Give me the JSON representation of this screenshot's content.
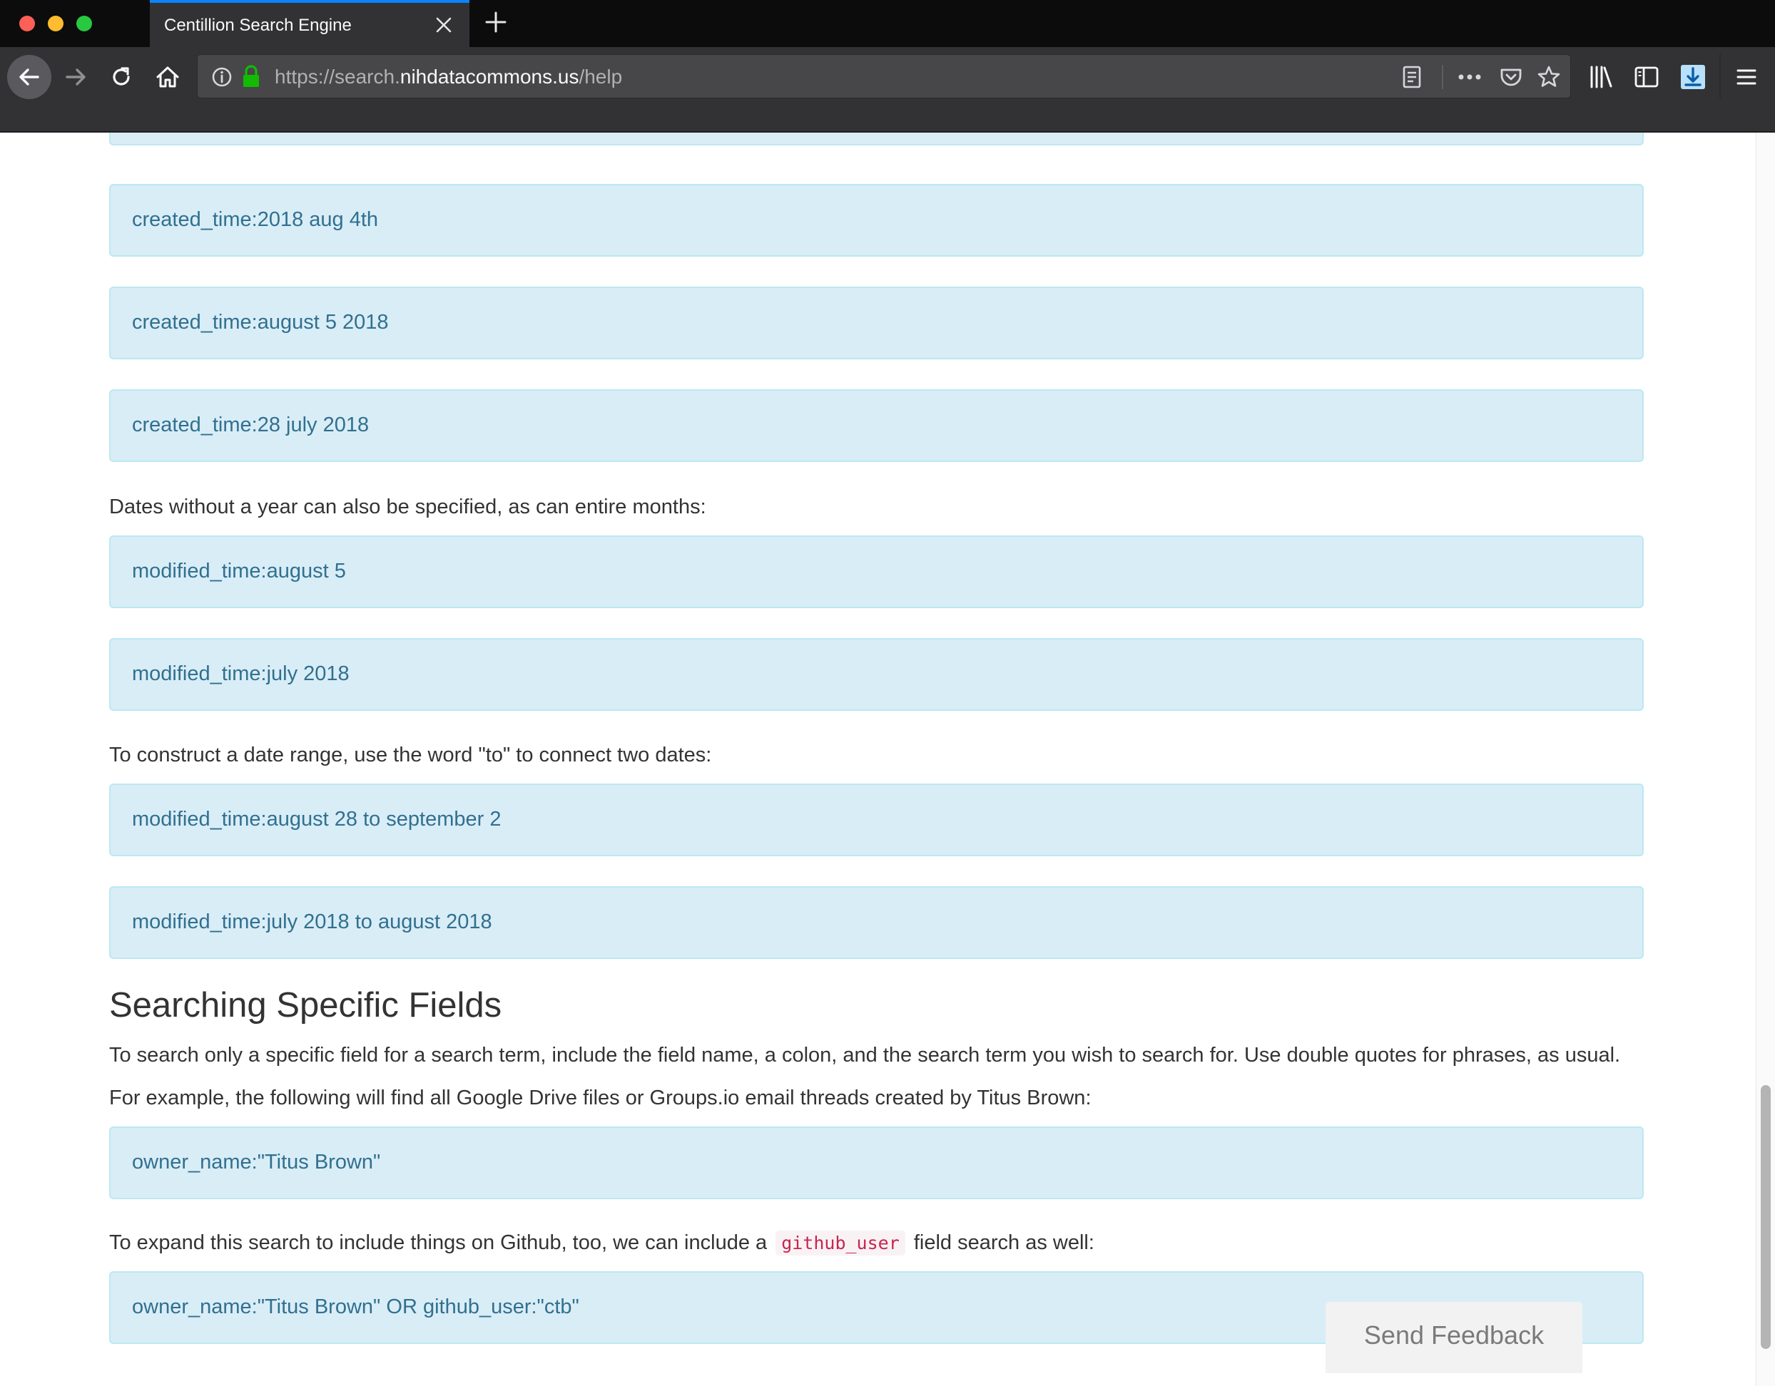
{
  "browser": {
    "tab_title": "Centillion Search Engine",
    "url": {
      "prefix": "https://search.",
      "domain": "nihdatacommons.us",
      "path": "/help"
    }
  },
  "content": {
    "wells_top": [
      "created_time:2018 aug 4th",
      "created_time:august 5 2018",
      "created_time:28 july 2018"
    ],
    "dates_note": "Dates without a year can also be specified, as can entire months:",
    "wells_months": [
      "modified_time:august 5",
      "modified_time:july 2018"
    ],
    "range_note": "To construct a date range, use the word \"to\" to connect two dates:",
    "wells_ranges": [
      "modified_time:august 28 to september 2",
      "modified_time:july 2018 to august 2018"
    ],
    "section_heading": "Searching Specific Fields",
    "fields_para1": "To search only a specific field for a search term, include the field name, a colon, and the search term you wish to search for. Use double quotes for phrases, as usual.",
    "fields_para2": "For example, the following will find all Google Drive files or Groups.io email threads created by Titus Brown:",
    "well_owner": "owner_name:\"Titus Brown\"",
    "expand_before": "To expand this search to include things on Github, too, we can include a",
    "expand_code": "github_user",
    "expand_after": "field search as well:",
    "well_owner_github": "owner_name:\"Titus Brown\" OR github_user:\"ctb\""
  },
  "feedback_button": "Send Feedback"
}
